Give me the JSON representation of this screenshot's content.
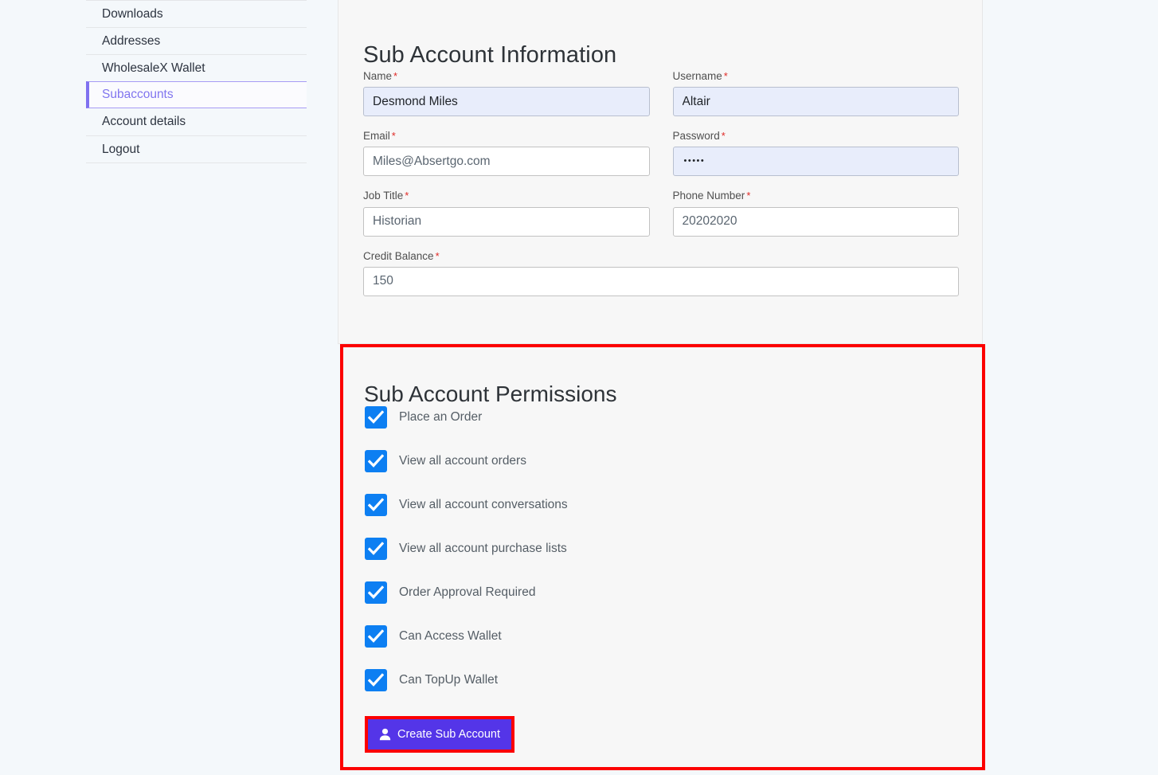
{
  "sidebar": {
    "items": [
      {
        "label": "Downloads",
        "active": false
      },
      {
        "label": "Addresses",
        "active": false
      },
      {
        "label": "WholesaleX Wallet",
        "active": false
      },
      {
        "label": "Subaccounts",
        "active": true
      },
      {
        "label": "Account details",
        "active": false
      },
      {
        "label": "Logout",
        "active": false
      }
    ],
    "active_color": "#8175ef",
    "active_border_color": "#7f71f0"
  },
  "account_info": {
    "title": "Sub Account Information",
    "required_marker": "*",
    "fields": [
      {
        "label": "Name",
        "value": "Desmond Miles",
        "required": true,
        "autofilled": true,
        "type": "text"
      },
      {
        "label": "Username",
        "value": "Altair",
        "required": true,
        "autofilled": true,
        "type": "text"
      },
      {
        "label": "Email",
        "value": "Miles@Absertgo.com",
        "required": true,
        "autofilled": false,
        "type": "email"
      },
      {
        "label": "Password",
        "value": "•••••",
        "masked_length": 5,
        "required": true,
        "autofilled": true,
        "type": "password"
      },
      {
        "label": "Job Title",
        "value": "Historian",
        "required": true,
        "autofilled": false,
        "type": "text"
      },
      {
        "label": "Phone Number",
        "value": "20202020",
        "required": true,
        "autofilled": false,
        "type": "tel"
      },
      {
        "label": "Credit Balance",
        "value": "150",
        "required": true,
        "autofilled": false,
        "type": "number"
      }
    ]
  },
  "permissions": {
    "title": "Sub Account Permissions",
    "checkbox_color": "#0d7ff2",
    "highlight_color": "#fc0000",
    "items": [
      {
        "label": "Place an Order",
        "checked": true
      },
      {
        "label": "View all account orders",
        "checked": true
      },
      {
        "label": "View all account conversations",
        "checked": true
      },
      {
        "label": "View all account purchase lists",
        "checked": true
      },
      {
        "label": "Order Approval Required",
        "checked": true
      },
      {
        "label": "Can Access Wallet",
        "checked": true
      },
      {
        "label": "Can TopUp Wallet",
        "checked": true
      }
    ]
  },
  "create_button": {
    "label": "Create Sub Account",
    "icon": "user-icon",
    "background": "#5435e8",
    "text_color": "#ffffff"
  }
}
